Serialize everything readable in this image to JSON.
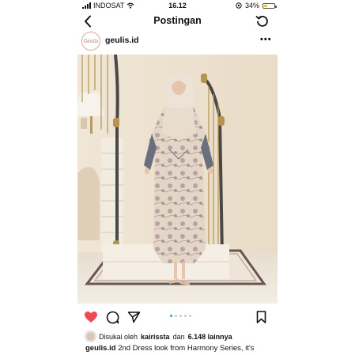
{
  "status_bar": {
    "carrier": "INDOSAT",
    "time": "16.12",
    "battery": "34%",
    "battery_level": 0.34
  },
  "nav": {
    "title": "Postingan",
    "back_icon": "chevron-left-icon",
    "refresh_icon": "refresh-icon"
  },
  "post": {
    "username": "geulis.id",
    "avatar_text": "Geulis",
    "more_icon": "more-horizontal-icon",
    "carousel": {
      "count": 5,
      "active": 1
    },
    "liked": true,
    "likes_prefix": "Disukai oleh",
    "likes_user": "kairissta",
    "likes_mid": "dan",
    "likes_count": "6.148 lainnya",
    "caption_user": "geulis.id",
    "caption_text": "2nd Dress look from Harmony Series, it's",
    "colors": {
      "like_red": "#ed4956",
      "carousel_active": "#3897f0"
    }
  }
}
